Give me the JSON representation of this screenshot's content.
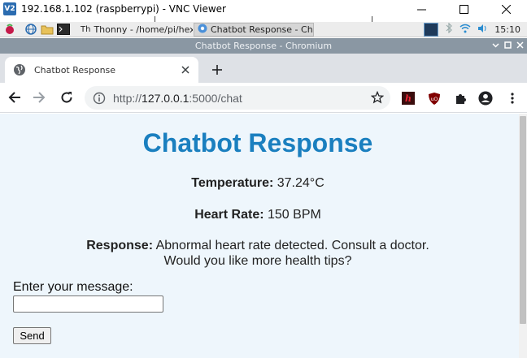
{
  "vnc": {
    "logo_text": "V2",
    "title": "192.168.1.102 (raspberrypi) - VNC Viewer"
  },
  "taskbar": {
    "windows": [
      {
        "label": "Thonny - /home/pi/hex..."
      },
      {
        "label": "Chatbot Response - Chr..."
      }
    ],
    "clock": "15:10"
  },
  "browser": {
    "window_title": "Chatbot Response - Chromium",
    "tab_title": "Chatbot Response",
    "url_prefix": "http://",
    "url_host": "127.0.0.1",
    "url_rest": ":5000/chat"
  },
  "page": {
    "heading": "Chatbot Response",
    "temperature_label": "Temperature:",
    "temperature_value": "37.24°C",
    "heart_rate_label": "Heart Rate:",
    "heart_rate_value": "150 BPM",
    "response_label": "Response:",
    "response_line1": "Abnormal heart rate detected. Consult a doctor.",
    "response_line2": "Would you like more health tips?",
    "message_label": "Enter your message:",
    "message_value": "",
    "send_label": "Send"
  },
  "colors": {
    "heading": "#1a7fbf",
    "page_background": "#eef6fc",
    "chromium_titlebar": "#8a97a3"
  }
}
